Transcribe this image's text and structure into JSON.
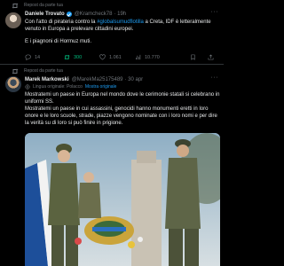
{
  "tweet1": {
    "repost_label": "Repost da parte tua",
    "name": "Daniele Trovato",
    "handle": "@Kramcheck78",
    "time": "· 19h",
    "text_plain": "Con l'atto di pirateria contro la ",
    "hashtag": "#globalsumudflotilla",
    "text_rest": " a Creta, IDF è letteralmente venuto in Europa a prelevare cittadini europei.",
    "text_line2": "E i piagnoni di Hormuz muti.",
    "stats": {
      "replies": "14",
      "reposts": "300",
      "likes": "1.061",
      "views": "10.770"
    }
  },
  "tweet2": {
    "repost_label": "Repost da parte tua",
    "name": "Marek Markowski",
    "handle": "@MarekMa25175489",
    "time": "· 30 apr",
    "translate_label": "Lingua originale: Polacco",
    "translate_action": "Mostra originale",
    "text_p1": "Mostratemi un paese in Europa nel mondo dove le cerimonie statali si celebrano in uniformi SS.",
    "text_p2": "Mostratemi un paese in cui assassini, genocidi hanno monumenti eretti in loro onore e le loro scuole, strade, piazze vengono nominate con i loro nomi e per dire la verità su di loro si può finire in prigione."
  },
  "colors": {
    "accent": "#1d9bf0",
    "repost_green": "#00ba7c",
    "muted": "#71767b",
    "bg": "#000000"
  }
}
